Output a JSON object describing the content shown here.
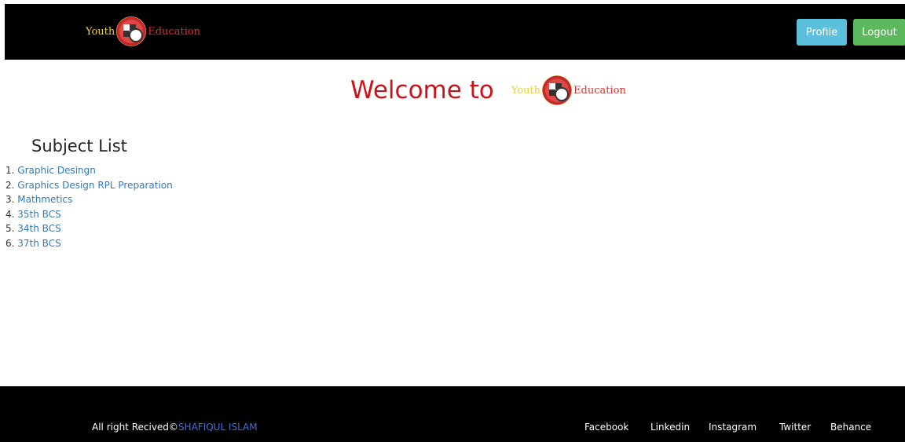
{
  "header": {
    "logo": {
      "left_word": "Youth",
      "right_word": "Education"
    },
    "buttons": {
      "profile": "Profile",
      "logout": "Logout"
    },
    "colors": {
      "bar": "#000000",
      "profile": "#5bc0de",
      "logout": "#5cb85c"
    }
  },
  "welcome": {
    "text": "Welcome to",
    "logo": {
      "left_word": "Youth",
      "right_word": "Education"
    }
  },
  "subjects": {
    "title": "Subject List",
    "items": [
      {
        "number": "1.",
        "label": "Graphic Desingn"
      },
      {
        "number": "2.",
        "label": "Graphics Design RPL Preparation"
      },
      {
        "number": "3.",
        "label": "Mathmetics"
      },
      {
        "number": "4.",
        "label": "35th BCS"
      },
      {
        "number": "5.",
        "label": "34th BCS"
      },
      {
        "number": "6.",
        "label": "37th BCS"
      }
    ]
  },
  "footer": {
    "copyright": {
      "text": "All right Recived",
      "symbol": "©",
      "author": "SHAFIQUL ISLAM"
    },
    "links": [
      "Facebook",
      "Linkedin",
      "Instagram",
      "Twitter",
      "Behance"
    ]
  }
}
